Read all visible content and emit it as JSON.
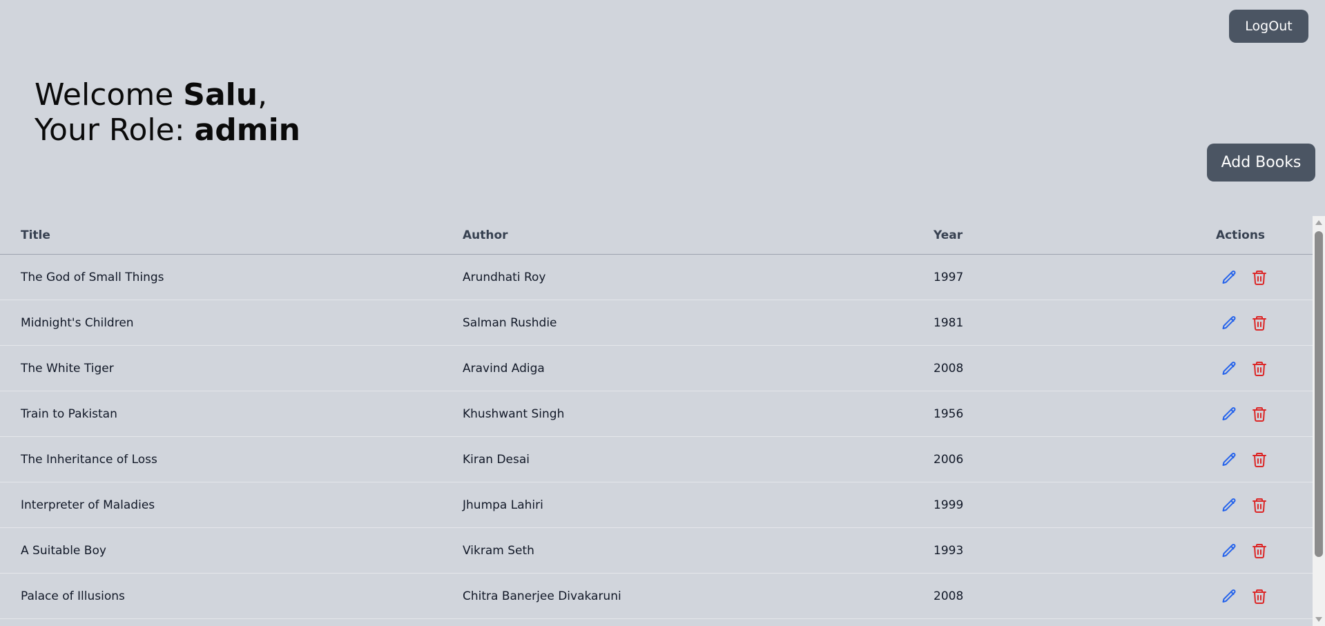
{
  "header": {
    "logout_label": "LogOut",
    "add_books_label": "Add Books"
  },
  "welcome": {
    "greeting": "Welcome ",
    "username": "Salu",
    "comma": ",",
    "role_prefix": "Your Role: ",
    "role": "admin"
  },
  "table": {
    "columns": [
      "Title",
      "Author",
      "Year",
      "Actions"
    ],
    "rows": [
      {
        "title": "The God of Small Things",
        "author": "Arundhati Roy",
        "year": "1997"
      },
      {
        "title": "Midnight's Children",
        "author": "Salman Rushdie",
        "year": "1981"
      },
      {
        "title": "The White Tiger",
        "author": "Aravind Adiga",
        "year": "2008"
      },
      {
        "title": "Train to Pakistan",
        "author": "Khushwant Singh",
        "year": "1956"
      },
      {
        "title": "The Inheritance of Loss",
        "author": "Kiran Desai",
        "year": "2006"
      },
      {
        "title": "Interpreter of Maladies",
        "author": "Jhumpa Lahiri",
        "year": "1999"
      },
      {
        "title": "A Suitable Boy",
        "author": "Vikram Seth",
        "year": "1993"
      },
      {
        "title": "Palace of Illusions",
        "author": "Chitra Banerjee Divakaruni",
        "year": "2008"
      }
    ],
    "edit_icon": "pencil-icon",
    "delete_icon": "trash-icon"
  },
  "colors": {
    "background": "#d1d5dc",
    "button": "#4b5563",
    "edit": "#2563eb",
    "delete": "#dc2626"
  }
}
